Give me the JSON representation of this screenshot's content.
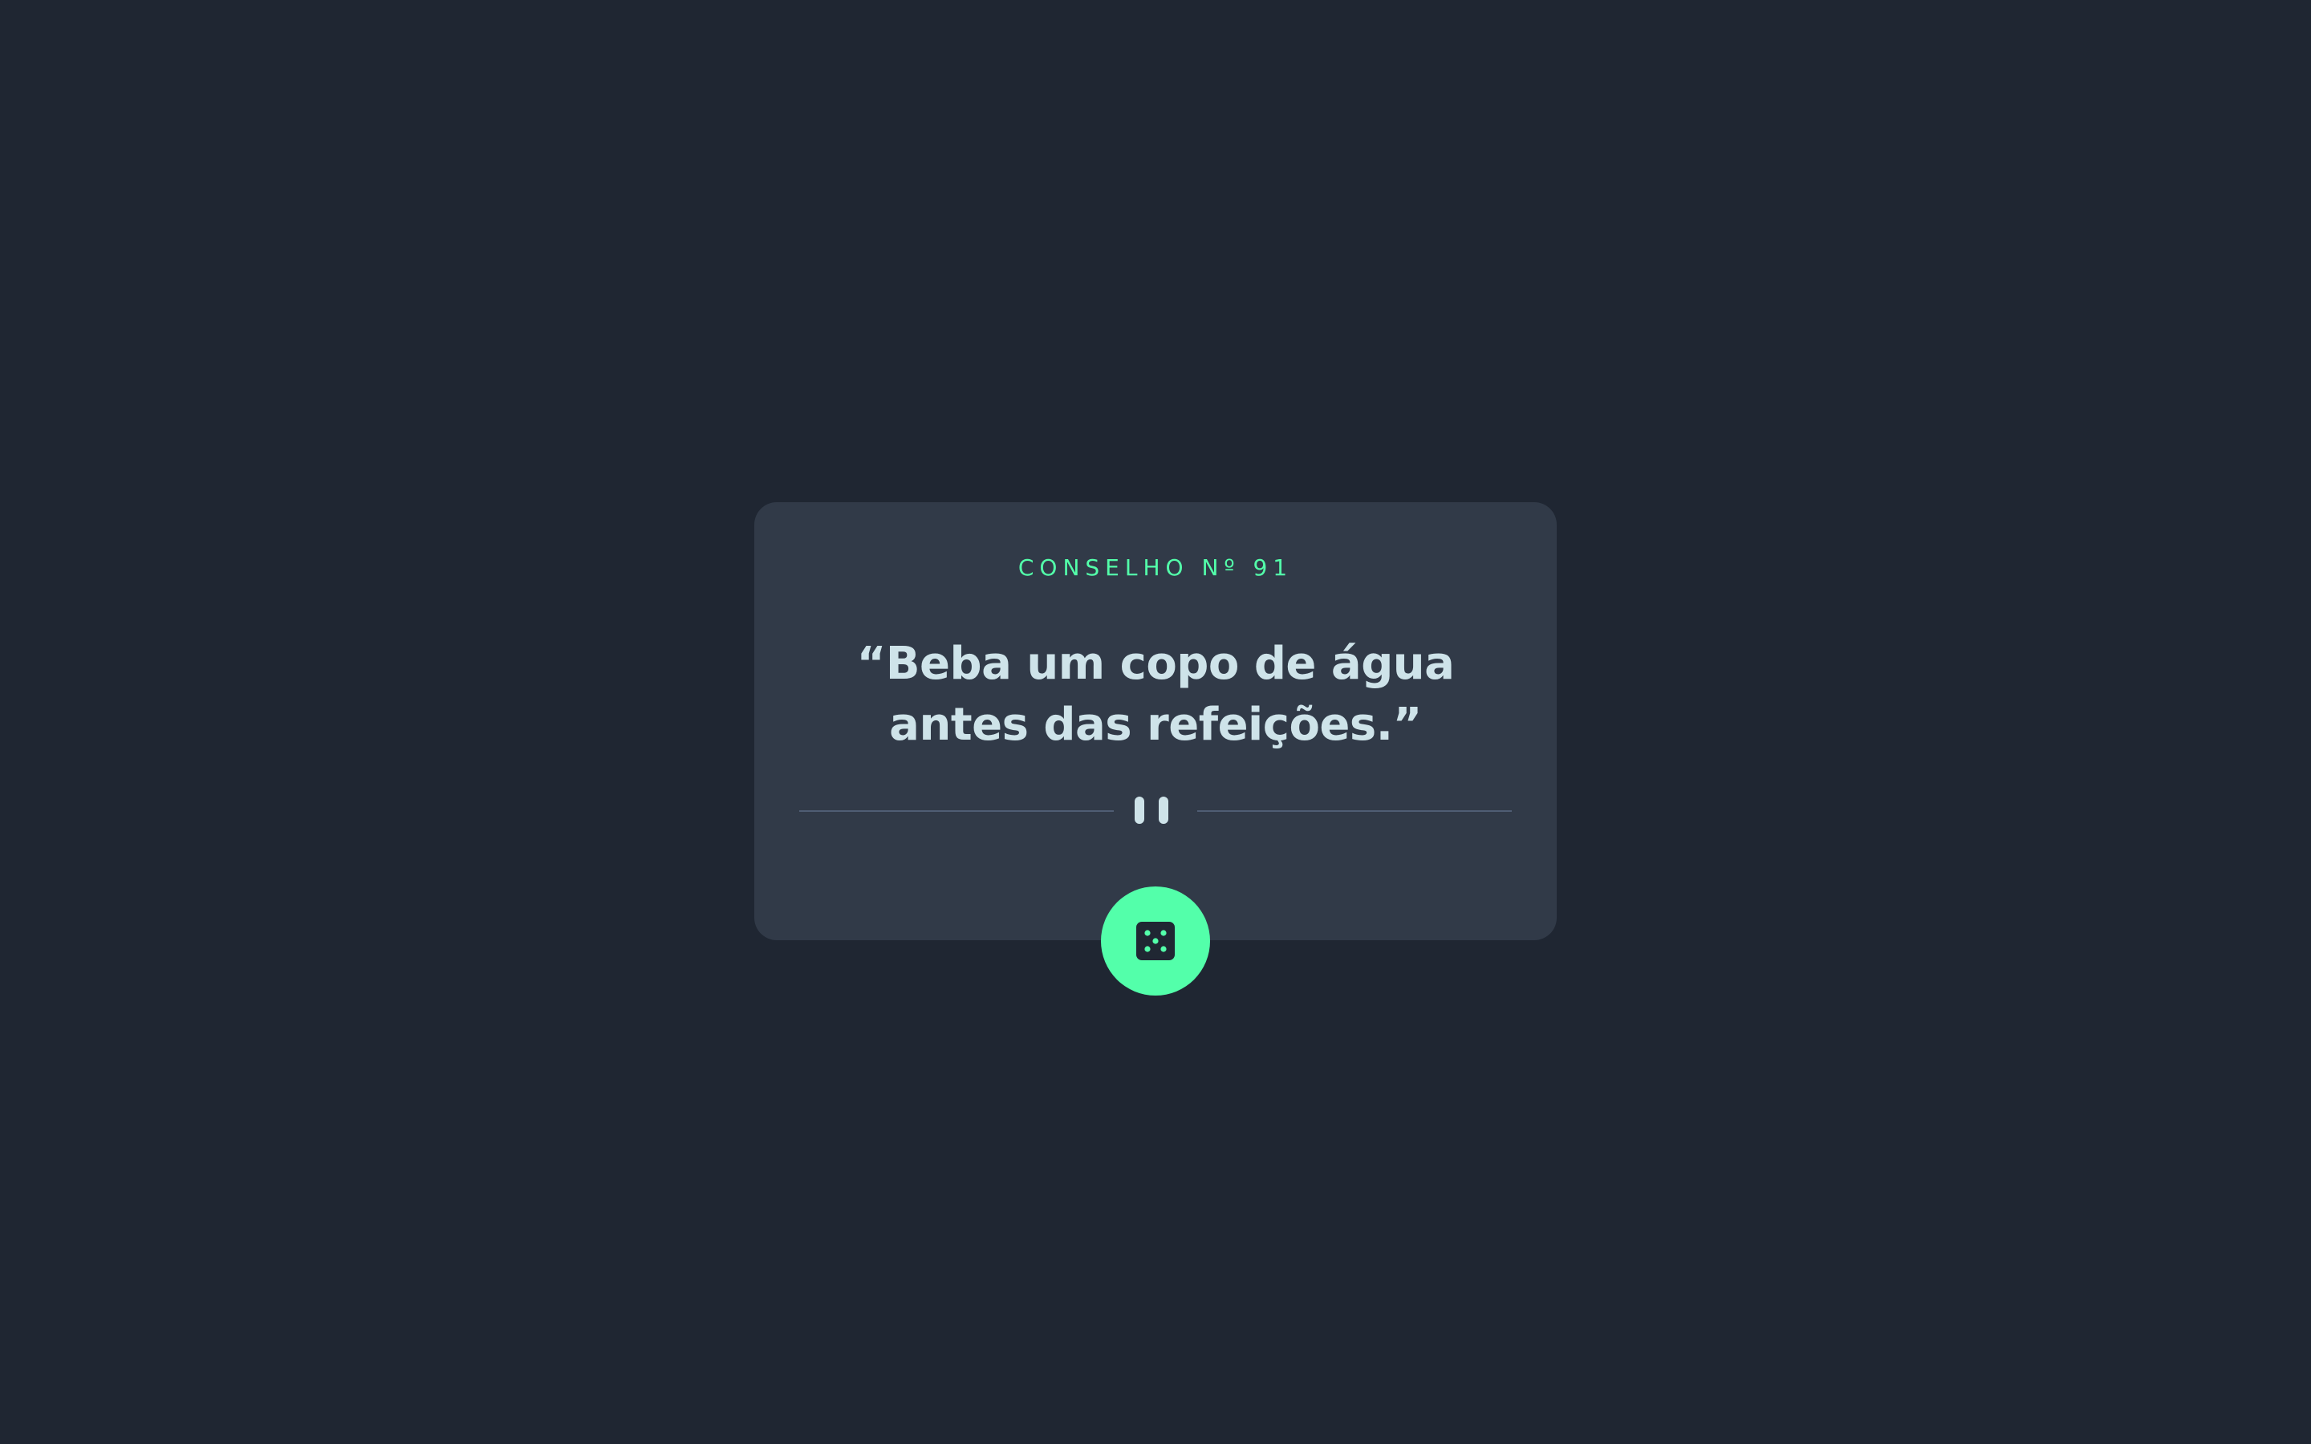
{
  "advice": {
    "label": "CONSELHO Nº 91",
    "text": "“Beba um copo de água antes das refeições.”"
  },
  "divider": {
    "icon": "pause-icon"
  },
  "button": {
    "icon": "dice-icon"
  },
  "colors": {
    "background": "#1f2632",
    "card": "#313a48",
    "accent": "#53ffaa",
    "quote_text": "#cee3e9",
    "divider": "#4f5d74"
  }
}
